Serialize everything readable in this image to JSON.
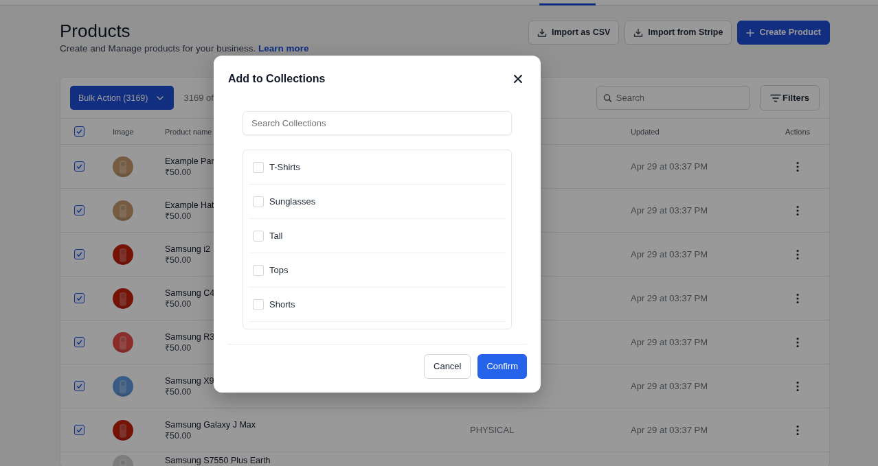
{
  "header": {
    "title": "Products",
    "subtitle": "Create and Manage products for your business.",
    "learn_more": "Learn more"
  },
  "actions": [
    {
      "kind": "import",
      "label": "Import as CSV"
    },
    {
      "kind": "import",
      "label": "Import from Stripe"
    },
    {
      "kind": "create",
      "label": "Create Product"
    }
  ],
  "toolbar": {
    "bulk_action": "Bulk Action (3169)",
    "count": "3169 of",
    "search_placeholder": "Search",
    "filters": "Filters"
  },
  "table": {
    "header": {
      "checked": true,
      "image": "Image",
      "name": "Product name",
      "updated": "Updated",
      "actions": "Actions"
    },
    "rows": [
      {
        "selected": true,
        "name": "Example Par",
        "price": "₹50.00",
        "updated": "Apr 29 at 03:37 PM"
      },
      {
        "selected": true,
        "name": "Example Hat",
        "price": "₹50.00",
        "updated": "Apr 29 at 03:37 PM"
      },
      {
        "selected": true,
        "name": "Samsung i2",
        "price": "₹50.00",
        "updated": "Apr 29 at 03:37 PM"
      },
      {
        "selected": true,
        "name": "Samsung C4",
        "price": "₹50.00",
        "updated": "Apr 29 at 03:37 PM"
      },
      {
        "selected": true,
        "name": "Samsung R3",
        "price": "₹50.00",
        "updated": "Apr 29 at 03:37 PM"
      },
      {
        "selected": true,
        "name": "Samsung X9",
        "price": "₹50.00",
        "updated": "Apr 29 at 03:37 PM"
      },
      {
        "selected": true,
        "name": "Samsung Galaxy J Max",
        "price": "₹50.00",
        "type": "PHYSICAL",
        "updated": "Apr 29 at 03:37 PM"
      },
      {
        "name": "Samsung S7550 Plus Earth"
      }
    ]
  },
  "modal": {
    "title": "Add to Collections",
    "search_placeholder": "Search Collections",
    "collections": [
      {
        "label": "T-Shirts",
        "checked": false
      },
      {
        "label": "Sunglasses",
        "checked": false
      },
      {
        "label": "Tall",
        "checked": false
      },
      {
        "label": "Tops",
        "checked": false
      },
      {
        "label": "Shorts",
        "checked": false
      }
    ],
    "cancel": "Cancel",
    "confirm": "Confirm"
  }
}
